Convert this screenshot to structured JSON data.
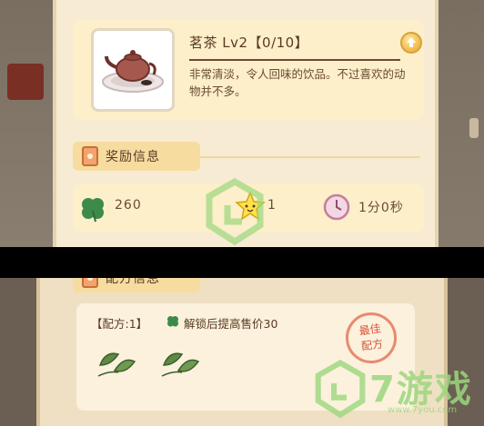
{
  "item": {
    "name": "茗茶 Lv2【0/10】",
    "description": "非常清淡，令人回味的饮品。不过喜欢的动物并不多。"
  },
  "reward_section": {
    "title": "奖励信息",
    "clover_value": "260",
    "star_value": "1",
    "time_value": "1分0秒"
  },
  "recipe_section": {
    "title": "配方信息",
    "recipe_label": "【配方:1】",
    "unlock_text": "解锁后提高售价30",
    "best_stamp": "最佳\n配方"
  },
  "watermark": {
    "brand": "7游戏",
    "url": "www.7you.com"
  },
  "colors": {
    "panel": "#f7ebd3",
    "card": "#fcefc9",
    "header": "#f6dc9f",
    "text": "#5a3a24",
    "clover": "#3d8a4a",
    "stamp": "#d8553c"
  }
}
